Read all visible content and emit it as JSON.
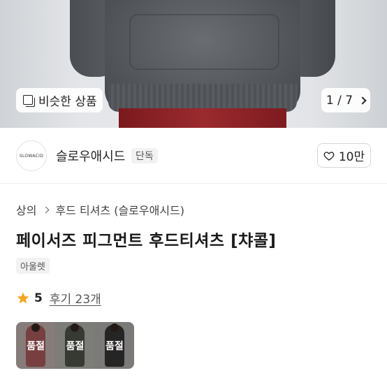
{
  "hero": {
    "similar_label": "비슷한 상품",
    "pager": "1 / 7",
    "icons": {
      "similar": "similar-items-icon",
      "next": "chevron-right-icon"
    }
  },
  "shop": {
    "logo_text": "SLOWACID",
    "name": "슬로우애시드",
    "badge": "단독",
    "like_count": "10만",
    "icons": {
      "like": "heart-icon"
    }
  },
  "breadcrumb": {
    "level1": "상의",
    "level2": "후드 티셔츠 (슬로우애시드)"
  },
  "product": {
    "title": "페이서즈 피그먼트 후드티셔츠 [챠콜]",
    "tag": "아울렛",
    "rating": "5",
    "reviews": "후기 23개",
    "accent_star_color": "#f5a623"
  },
  "options": [
    {
      "status": "품절"
    },
    {
      "status": "품절"
    },
    {
      "status": "품절"
    }
  ]
}
